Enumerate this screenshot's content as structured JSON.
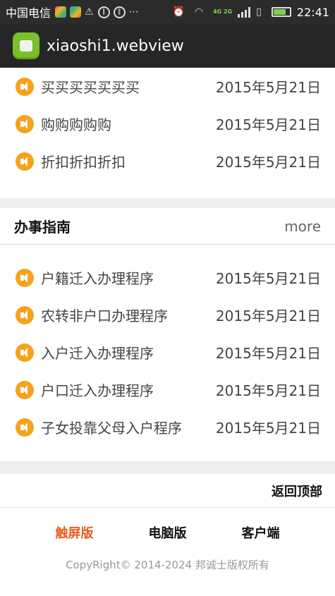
{
  "statusbar": {
    "carrier": "中国电信",
    "network_label": "4G 2G",
    "time": "22:41"
  },
  "appbar": {
    "title": "xiaoshi1.webview",
    "icon": "android-icon"
  },
  "top_news": [
    {
      "title": "买买买买买买买",
      "date": "2015年5月21日"
    },
    {
      "title": "购购购购购",
      "date": "2015年5月21日"
    },
    {
      "title": "折扣折扣折扣",
      "date": "2015年5月21日"
    }
  ],
  "guide": {
    "title": "办事指南",
    "more": "more",
    "items": [
      {
        "title": "户籍迁入办理程序",
        "date": "2015年5月21日"
      },
      {
        "title": "农转非户口办理程序",
        "date": "2015年5月21日"
      },
      {
        "title": "入户迁入办理程序",
        "date": "2015年5月21日"
      },
      {
        "title": "户口迁入办理程序",
        "date": "2015年5月21日"
      },
      {
        "title": "子女投靠父母入户程序",
        "date": "2015年5月21日"
      }
    ]
  },
  "back_to_top": "返回顶部",
  "footer": {
    "nav": [
      "触屏版",
      "电脑版",
      "客户端"
    ],
    "active_index": 0,
    "copyright": "CopyRight© 2014-2024 邦诚士版权所有"
  },
  "colors": {
    "accent": "#e95b1c",
    "speaker": "#f7a21c",
    "appbar": "#262626"
  }
}
